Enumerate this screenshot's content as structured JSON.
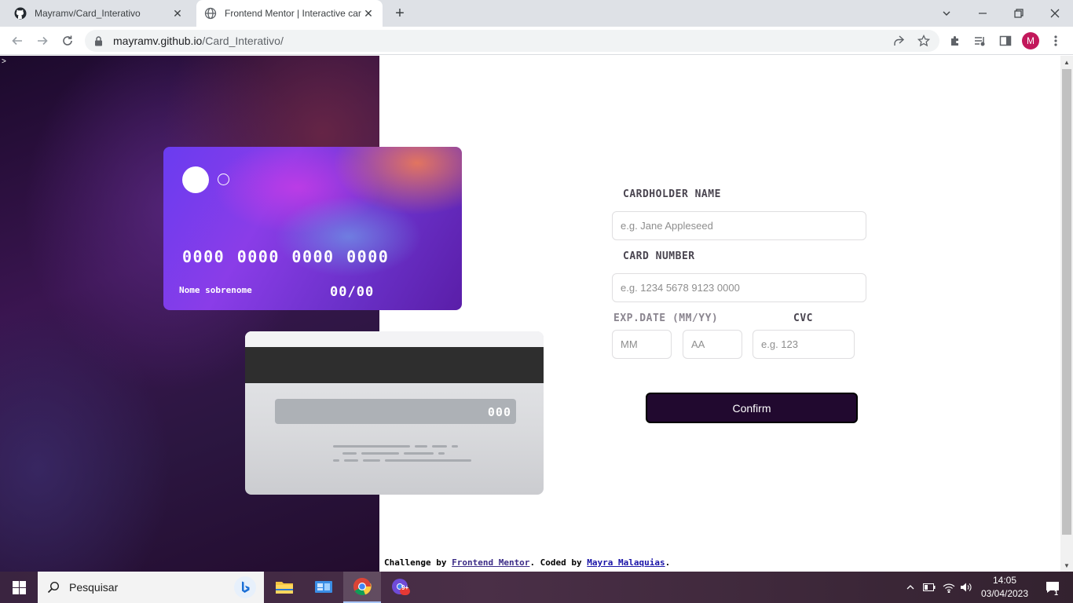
{
  "browser": {
    "tabs": [
      {
        "title": "Mayramv/Card_Interativo",
        "icon": "github-icon"
      },
      {
        "title": "Frontend Mentor | Interactive car",
        "icon": "globe-icon"
      }
    ],
    "url_host": "mayramv.github.io",
    "url_path": "/Card_Interativo/",
    "profile_initial": "M"
  },
  "card_front": {
    "number": "0000 0000 0000 0000",
    "name": "Nome sobrenome",
    "expiry": "00/00"
  },
  "card_back": {
    "cvc": "000"
  },
  "form": {
    "cardholder_label": "CARDHOLDER NAME",
    "cardholder_placeholder": "e.g. Jane Appleseed",
    "number_label": "CARD NUMBER",
    "number_placeholder": "e.g. 1234 5678 9123 0000",
    "exp_label": "EXP.DATE (MM/YY)",
    "month_placeholder": "MM",
    "year_placeholder": "AA",
    "cvc_label": "CVC",
    "cvc_placeholder": "e.g. 123",
    "confirm_label": "Confirm"
  },
  "attribution": {
    "prefix": "Challenge by ",
    "link1": "Frontend Mentor",
    "middle": ". Coded by ",
    "link2": "Mayra Malaquias",
    "suffix": "."
  },
  "taskbar": {
    "search_label": "Pesquisar",
    "time": "14:05",
    "date": "03/04/2023",
    "notification_count": "1",
    "badge": "9+"
  },
  "colors": {
    "confirm_bg": "#21092f",
    "profile_bg": "#c2185b"
  }
}
